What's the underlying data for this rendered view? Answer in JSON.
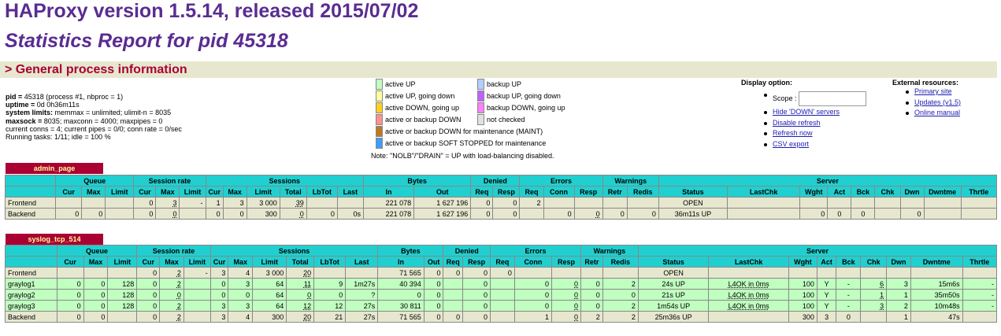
{
  "header": {
    "title": "HAProxy version 1.5.14, released 2015/07/02",
    "subtitle": "Statistics Report for pid 45318",
    "general_section": "> General process information"
  },
  "process_info": [
    {
      "label": "pid = ",
      "value": "45318 (process #1, nbproc = 1)"
    },
    {
      "label": "uptime = ",
      "value": "0d 0h36m11s"
    },
    {
      "label": "system limits:",
      "value": " memmax = unlimited; ulimit-n = 8035"
    },
    {
      "label": "maxsock = ",
      "value": "8035; maxconn = 4000; maxpipes = 0"
    },
    {
      "label": "",
      "value": "current conns = 4; current pipes = 0/0; conn rate = 0/sec"
    },
    {
      "label": "",
      "value": "Running tasks: 1/11; idle = 100 %"
    }
  ],
  "legend": {
    "items": [
      {
        "label": "active UP",
        "color": "#c0ffc0"
      },
      {
        "label": "active UP, going down",
        "color": "#ffffa0"
      },
      {
        "label": "active DOWN, going up",
        "color": "#ffd020"
      },
      {
        "label": "active or backup DOWN",
        "color": "#ff9090"
      },
      {
        "label": "active or backup DOWN for maintenance (MAINT)",
        "color": "#c07820"
      },
      {
        "label": "active or backup SOFT STOPPED for maintenance",
        "color": "#3d9eff"
      },
      {
        "label": "backup UP",
        "color": "#b0d0ff"
      },
      {
        "label": "backup UP, going down",
        "color": "#c060ff"
      },
      {
        "label": "backup DOWN, going up",
        "color": "#ff80ff"
      },
      {
        "label": "not checked",
        "color": "#e0e0e0"
      }
    ],
    "note": "Note: \"NOLB\"/\"DRAIN\" = UP with load-balancing disabled."
  },
  "display_option": {
    "title": "Display option:",
    "scope_label": "Scope : ",
    "scope_value": "",
    "links": [
      "Hide 'DOWN' servers",
      "Disable refresh",
      "Refresh now",
      "CSV export"
    ]
  },
  "external_resources": {
    "title": "External resources:",
    "links": [
      "Primary site",
      "Updates (v1.5)",
      "Online manual"
    ]
  },
  "proxies": [
    {
      "name": "admin_page",
      "group_headers": [
        "",
        "Queue",
        "Session rate",
        "Sessions",
        "Bytes",
        "Denied",
        "Errors",
        "Warnings",
        "Server"
      ],
      "columns": [
        "",
        "Cur",
        "Max",
        "Limit",
        "Cur",
        "Max",
        "Limit",
        "Cur",
        "Max",
        "Limit",
        "Total",
        "LbTot",
        "Last",
        "In",
        "Out",
        "Req",
        "Resp",
        "Req",
        "Conn",
        "Resp",
        "Retr",
        "Redis",
        "Status",
        "LastChk",
        "Wght",
        "Act",
        "Bck",
        "Chk",
        "Dwn",
        "Dwntme",
        "Thrtle"
      ],
      "rows": [
        {
          "kind": "fe",
          "cells": [
            "Frontend",
            "",
            "",
            "",
            "0",
            "3",
            "-",
            "1",
            "3",
            "3 000",
            "39",
            "",
            "",
            "221 078",
            "1 627 196",
            "0",
            "0",
            "2",
            "",
            "",
            "",
            "",
            "OPEN",
            "",
            "",
            "",
            "",
            "",
            "",
            "",
            ""
          ]
        },
        {
          "kind": "be",
          "cells": [
            "Backend",
            "0",
            "0",
            "",
            "0",
            "0",
            "",
            "0",
            "0",
            "300",
            "0",
            "0",
            "0s",
            "221 078",
            "1 627 196",
            "0",
            "0",
            "",
            "0",
            "0",
            "0",
            "0",
            "36m11s UP",
            "",
            "0",
            "0",
            "0",
            "",
            "0",
            "",
            ""
          ]
        }
      ]
    },
    {
      "name": "syslog_tcp_514",
      "group_headers": [
        "",
        "Queue",
        "Session rate",
        "Sessions",
        "Bytes",
        "Denied",
        "Errors",
        "Warnings",
        "Server"
      ],
      "columns": [
        "",
        "Cur",
        "Max",
        "Limit",
        "Cur",
        "Max",
        "Limit",
        "Cur",
        "Max",
        "Limit",
        "Total",
        "LbTot",
        "Last",
        "In",
        "Out",
        "Req",
        "Resp",
        "Req",
        "Conn",
        "Resp",
        "Retr",
        "Redis",
        "Status",
        "LastChk",
        "Wght",
        "Act",
        "Bck",
        "Chk",
        "Dwn",
        "Dwntme",
        "Thrtle"
      ],
      "rows": [
        {
          "kind": "fe",
          "cells": [
            "Frontend",
            "",
            "",
            "",
            "0",
            "2",
            "-",
            "3",
            "4",
            "3 000",
            "20",
            "",
            "",
            "71 565",
            "0",
            "0",
            "0",
            "0",
            "",
            "",
            "",
            "",
            "OPEN",
            "",
            "",
            "",
            "",
            "",
            "",
            "",
            ""
          ]
        },
        {
          "kind": "up",
          "cells": [
            "graylog1",
            "0",
            "0",
            "128",
            "0",
            "2",
            "",
            "0",
            "3",
            "64",
            "11",
            "9",
            "1m27s",
            "40 394",
            "0",
            "",
            "0",
            "",
            "0",
            "0",
            "0",
            "2",
            "24s UP",
            "L4OK in 0ms",
            "100",
            "Y",
            "-",
            "6",
            "3",
            "15m6s",
            "-"
          ]
        },
        {
          "kind": "up",
          "cells": [
            "graylog2",
            "0",
            "0",
            "128",
            "0",
            "0",
            "",
            "0",
            "0",
            "64",
            "0",
            "0",
            "?",
            "0",
            "0",
            "",
            "0",
            "",
            "0",
            "0",
            "0",
            "0",
            "21s UP",
            "L4OK in 0ms",
            "100",
            "Y",
            "-",
            "1",
            "1",
            "35m50s",
            "-"
          ]
        },
        {
          "kind": "up",
          "cells": [
            "graylog3",
            "0",
            "0",
            "128",
            "0",
            "2",
            "",
            "3",
            "3",
            "64",
            "12",
            "12",
            "27s",
            "30 811",
            "0",
            "",
            "0",
            "",
            "0",
            "0",
            "0",
            "2",
            "1m54s UP",
            "L4OK in 0ms",
            "100",
            "Y",
            "-",
            "3",
            "2",
            "10m48s",
            "-"
          ]
        },
        {
          "kind": "be",
          "cells": [
            "Backend",
            "0",
            "0",
            "",
            "0",
            "2",
            "",
            "3",
            "4",
            "300",
            "20",
            "21",
            "27s",
            "71 565",
            "0",
            "0",
            "0",
            "",
            "1",
            "0",
            "2",
            "2",
            "25m36s UP",
            "",
            "300",
            "3",
            "0",
            "",
            "1",
            "47s",
            ""
          ]
        }
      ]
    }
  ]
}
